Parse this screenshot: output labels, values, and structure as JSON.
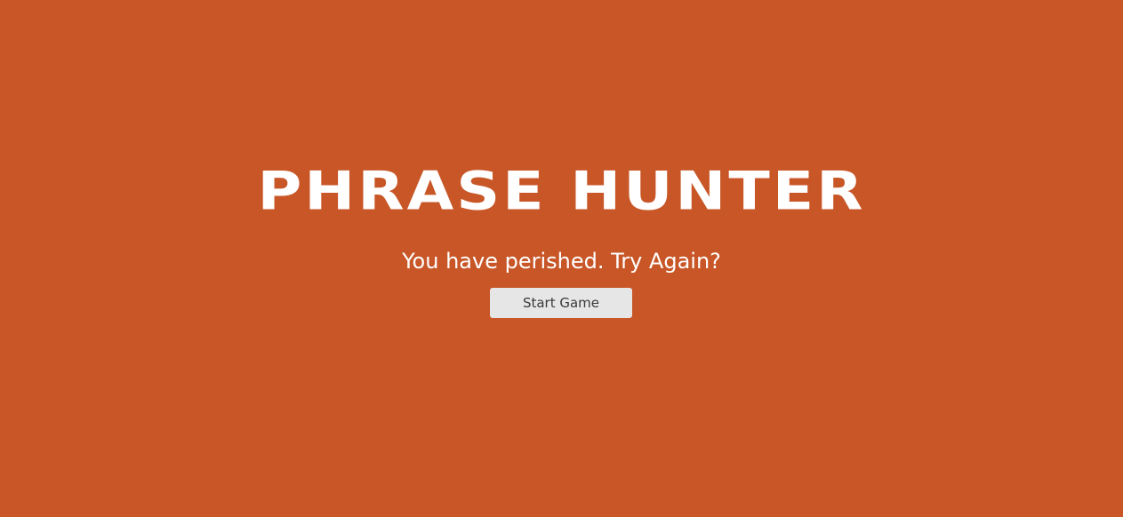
{
  "overlay": {
    "title": "PHRASE HUNTER",
    "message": "You have perished. Try Again?",
    "start_button_label": "Start Game"
  },
  "colors": {
    "background": "#c85627",
    "title_text": "#ffffff",
    "button_background": "#e6e6e6",
    "button_text": "#3a3a3a"
  }
}
